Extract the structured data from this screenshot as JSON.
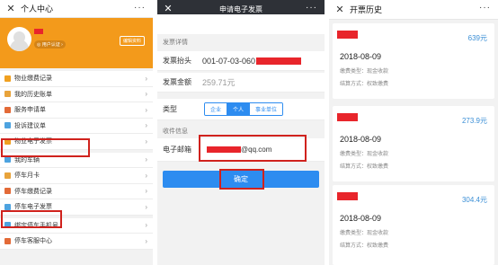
{
  "personal_center": {
    "title": "个人中心",
    "more": "···",
    "auth_badge": "◎ 用户认证 ›",
    "edit_button": "编辑资料",
    "menu": [
      {
        "label": "物业缴费记录",
        "icon": "bill-icon",
        "color": "#f0a020"
      },
      {
        "label": "我的历史账单",
        "icon": "history-icon",
        "color": "#e8a33b"
      },
      {
        "label": "服务申请单",
        "icon": "service-icon",
        "color": "#e36a37"
      },
      {
        "label": "投诉建议单",
        "icon": "feedback-icon",
        "color": "#4da3e0"
      },
      {
        "label": "物业电子发票",
        "icon": "invoice-icon",
        "color": "#f0a020"
      },
      {
        "label": "我的车辆",
        "icon": "car-icon",
        "color": "#4da3e0"
      },
      {
        "label": "停车月卡",
        "icon": "parking-card-icon",
        "color": "#e8a33b"
      },
      {
        "label": "停车缴费记录",
        "icon": "parking-fee-icon",
        "color": "#e36a37"
      },
      {
        "label": "停车电子发票",
        "icon": "parking-invoice-icon",
        "color": "#4da3e0"
      },
      {
        "label": "绑定停车手机号",
        "icon": "phone-icon",
        "color": "#4da3e0"
      },
      {
        "label": "停车客服中心",
        "icon": "support-icon",
        "color": "#e36a37"
      }
    ]
  },
  "invoice_form": {
    "title": "申请电子发票",
    "more": "···",
    "details_header": "发票详情",
    "header_label": "发票抬头",
    "header_value": "001-07-03-060",
    "amount_label": "发票金额",
    "amount_value": "259.71元",
    "type_label": "类型",
    "type_options": [
      "企业",
      "个人",
      "事业单位"
    ],
    "type_selected": 1,
    "receive_header": "收件信息",
    "email_label": "电子邮箱",
    "email_value": "@qq.com",
    "confirm_button": "确定"
  },
  "history": {
    "title": "开票历史",
    "more": "···",
    "records": [
      {
        "amount": "639元",
        "date": "2018-08-09",
        "fee_type": "缴费类型：现金收款",
        "settle": "结算方式：权致缴费"
      },
      {
        "amount": "273.9元",
        "date": "2018-08-09",
        "fee_type": "缴费类型：现金收款",
        "settle": "结算方式：权致缴费"
      },
      {
        "amount": "304.4元",
        "date": "2018-08-09",
        "fee_type": "缴费类型：现金收款",
        "settle": "结算方式：权致缴费"
      }
    ]
  },
  "colors": {
    "accent": "#f39a1b",
    "primary_blue": "#2d8cf0",
    "highlight_red": "#d0221d",
    "amount_blue": "#3b8fd6"
  }
}
